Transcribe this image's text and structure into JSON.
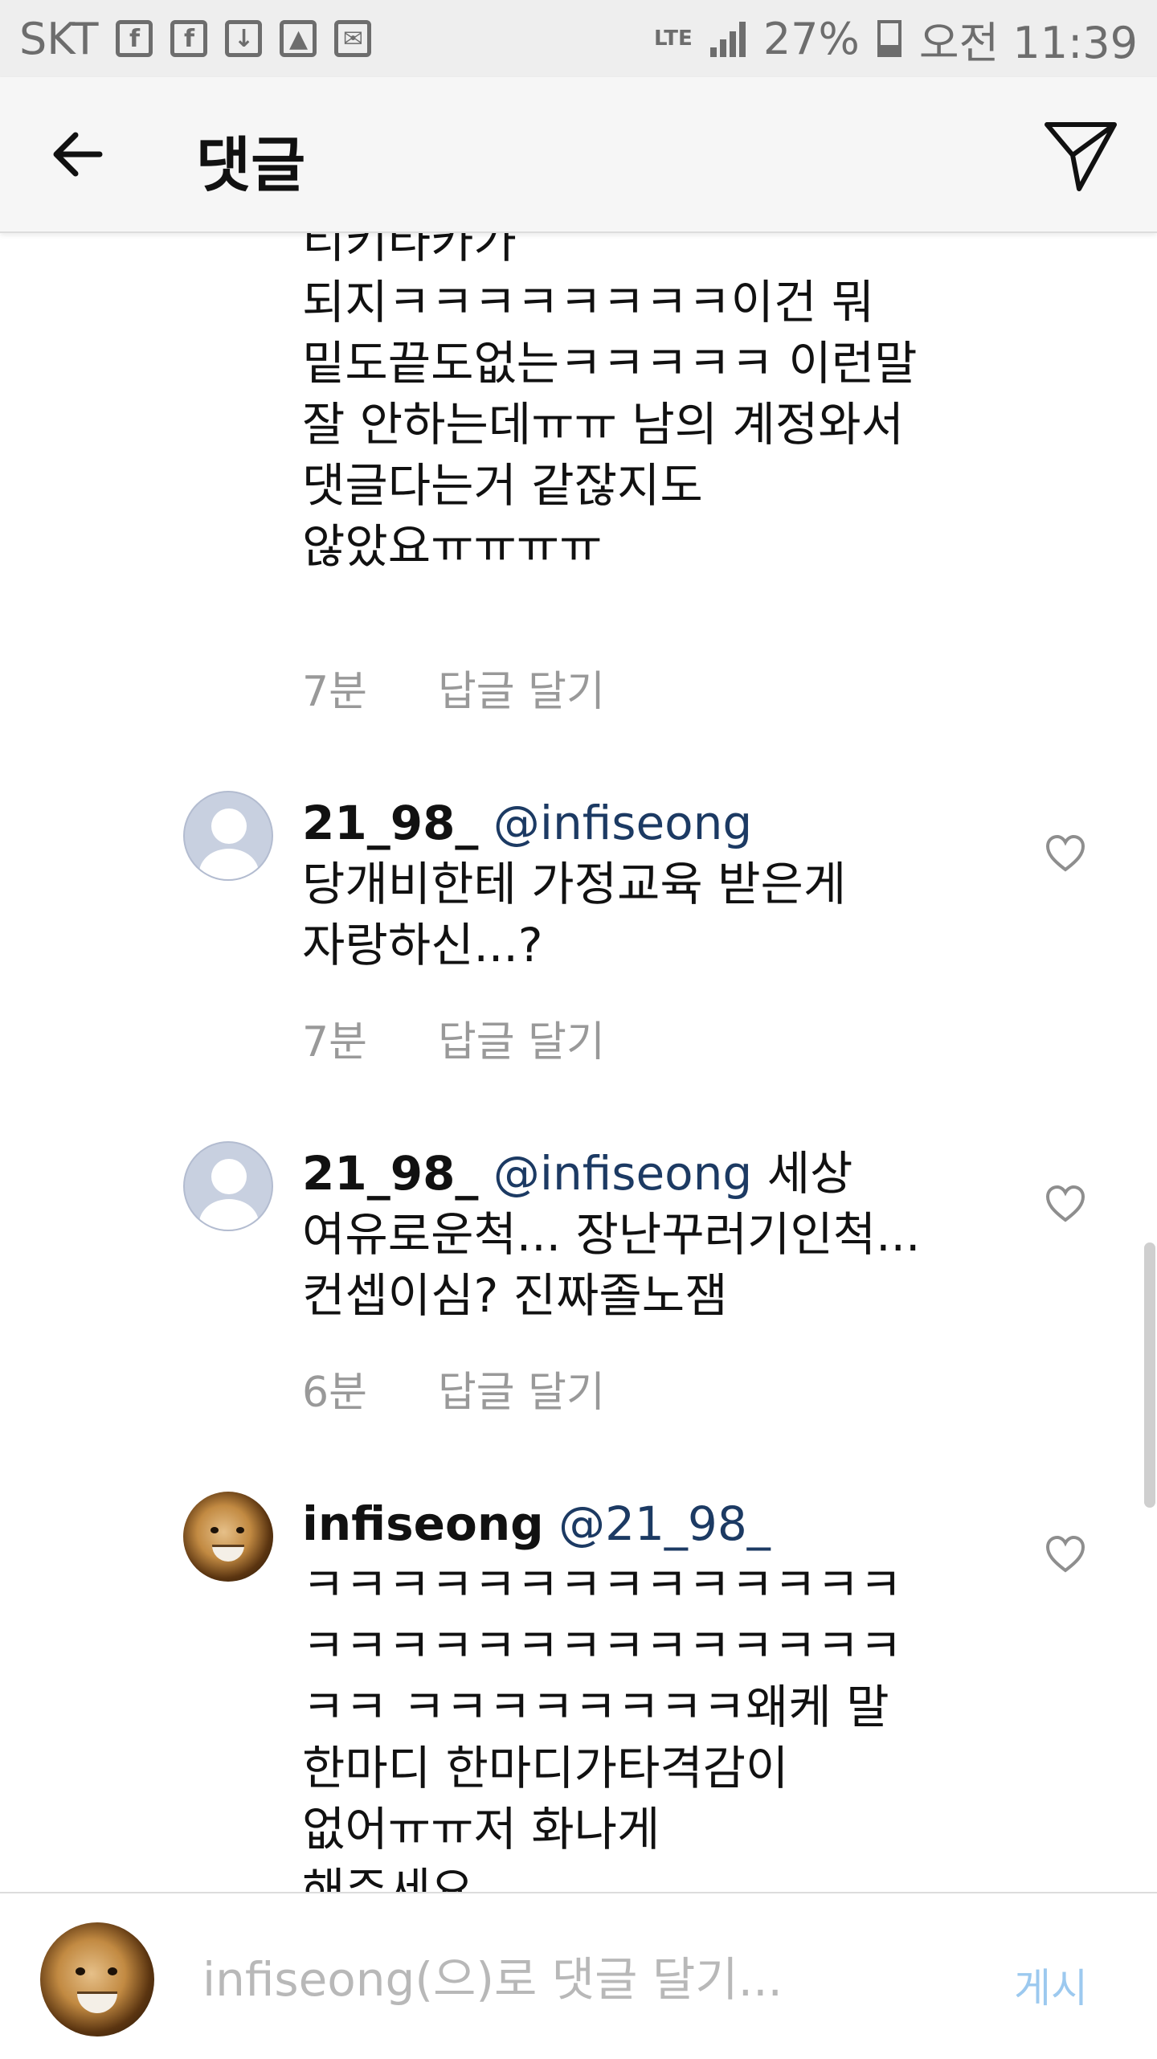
{
  "status_bar": {
    "carrier": "SKT",
    "network": "LTE",
    "battery": "27%",
    "time": "오전 11:39"
  },
  "header": {
    "title": "댓글"
  },
  "comments": [
    {
      "text": "티키타카가\n되지ㅋㅋㅋㅋㅋㅋㅋㅋ이건 뭐\n밑도끝도없는ㅋㅋㅋㅋㅋ 이런말\n잘 안하는데ㅠㅠ 남의 계정와서\n댓글다는거 같잖지도\n않았요ㅠㅠㅠㅠ",
      "time": "7분",
      "reply_label": "답글 달기"
    },
    {
      "username": "21_98_",
      "mention": "@infiseong",
      "text": "당개비한테 가정교육 받은게\n자랑하신...?",
      "time": "7분",
      "reply_label": "답글 달기"
    },
    {
      "username": "21_98_",
      "mention": "@infiseong",
      "text": "세상\n여유로운척... 장난꾸러기인척...\n컨셉이심? 진짜졸노잼",
      "time": "6분",
      "reply_label": "답글 달기"
    },
    {
      "username": "infiseong",
      "mention": "@21_98_",
      "text": "ㅋㅋㅋㅋㅋㅋㅋㅋㅋㅋㅋㅋㅋㅋ\nㅋㅋㅋㅋㅋㅋㅋㅋㅋㅋㅋㅋㅋㅋ\nㅋㅋ ㅋㅋㅋㅋㅋㅋㅋㅋ왜케 말\n한마디 한마디가타격감이\n없어ㅠㅠ저 화나게\n해주세요"
    }
  ],
  "input": {
    "placeholder": "infiseong(으)로 댓글 달기...",
    "post_label": "게시"
  },
  "icons": {
    "back": "arrow-left-icon",
    "send": "direct-send-icon",
    "like": "heart-icon"
  }
}
